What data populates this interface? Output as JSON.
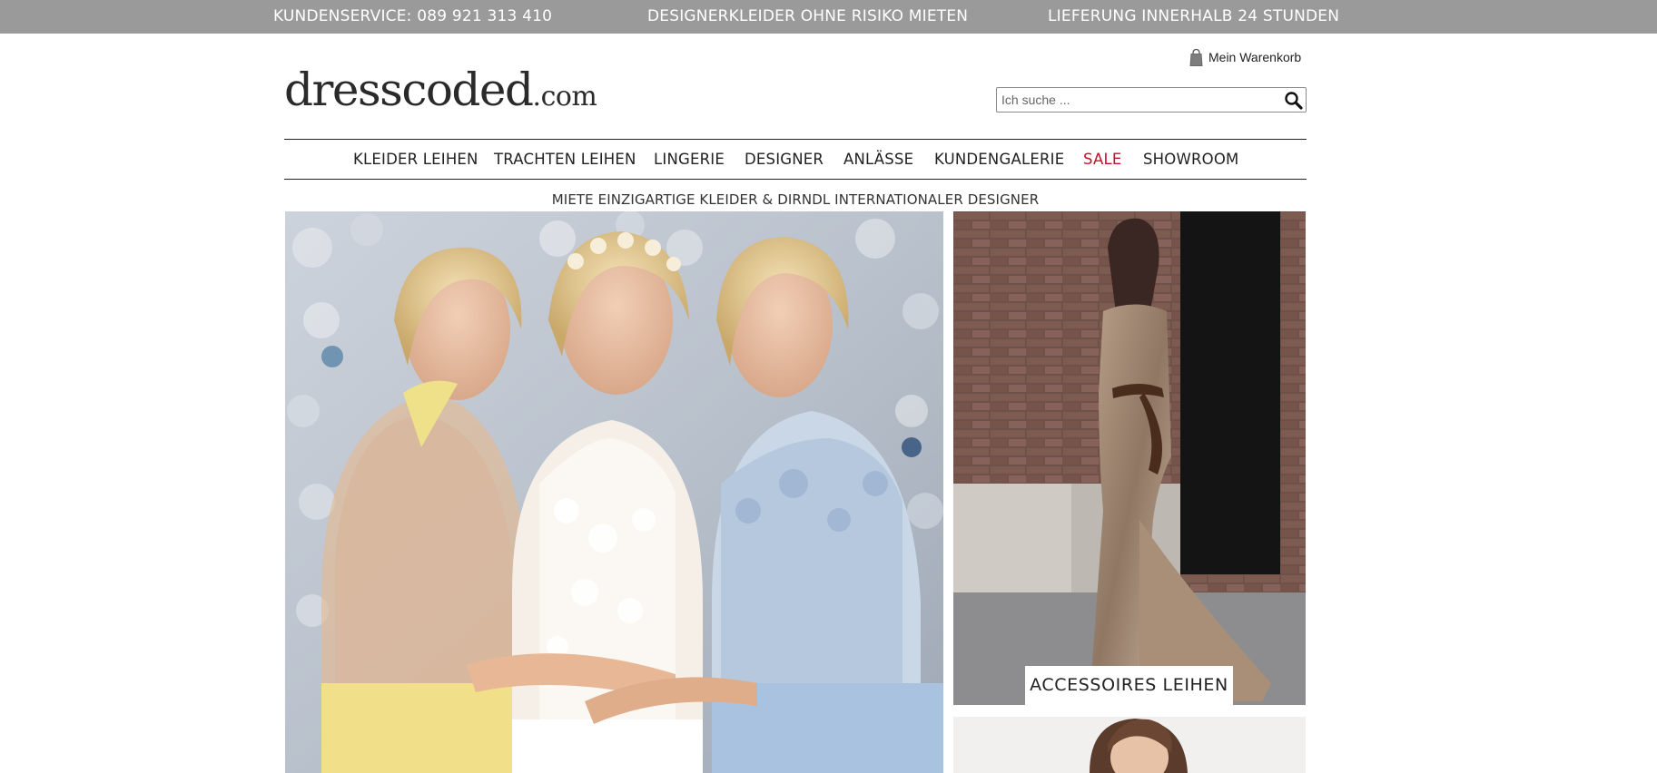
{
  "topbar": {
    "service": "KUNDENSERVICE: 089 921 313 410",
    "promise": "DESIGNERKLEIDER OHNE RISIKO MIETEN",
    "delivery": "LIEFERUNG INNERHALB 24 STUNDEN"
  },
  "cart": {
    "label": "Mein Warenkorb",
    "icon": "shopping-bag-icon"
  },
  "logo": {
    "main": "dresscoded",
    "tld": ".com"
  },
  "search": {
    "placeholder": "Ich suche ...",
    "value": "",
    "icon": "search-icon"
  },
  "nav": {
    "items": [
      {
        "label": "KLEIDER LEIHEN"
      },
      {
        "label": "TRACHTEN LEIHEN"
      },
      {
        "label": "LINGERIE"
      },
      {
        "label": "DESIGNER"
      },
      {
        "label": "ANLÄSSE"
      },
      {
        "label": "KUNDENGALERIE"
      },
      {
        "label": "SALE"
      },
      {
        "label": "SHOWROOM"
      }
    ]
  },
  "tagline": "MIETE EINZIGARTIGE KLEIDER & DIRNDL INTERNATIONALER DESIGNER",
  "hero": {
    "accessories_label": "ACCESSOIRES LEIHEN"
  },
  "colors": {
    "topbar_bg": "#9a9a9a",
    "sale": "#c8102e",
    "text": "#222222"
  }
}
